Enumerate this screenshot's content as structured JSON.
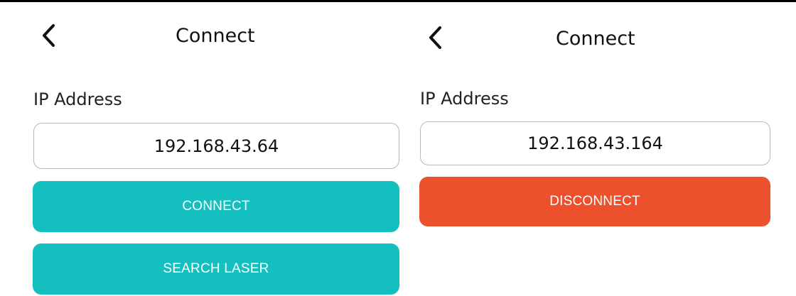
{
  "colors": {
    "connect": "#14bfbf",
    "search": "#14bfbf",
    "disconnect": "#ec502c"
  },
  "left_screen": {
    "back_icon": "chevron-left-icon",
    "title": "Connect",
    "ip_label": "IP Address",
    "ip_value": "192.168.43.64",
    "connect_label": "CONNECT",
    "search_label": "SEARCH LASER"
  },
  "right_screen": {
    "back_icon": "chevron-left-icon",
    "title": "Connect",
    "ip_label": "IP Address",
    "ip_value": "192.168.43.164",
    "disconnect_label": "DISCONNECT"
  }
}
